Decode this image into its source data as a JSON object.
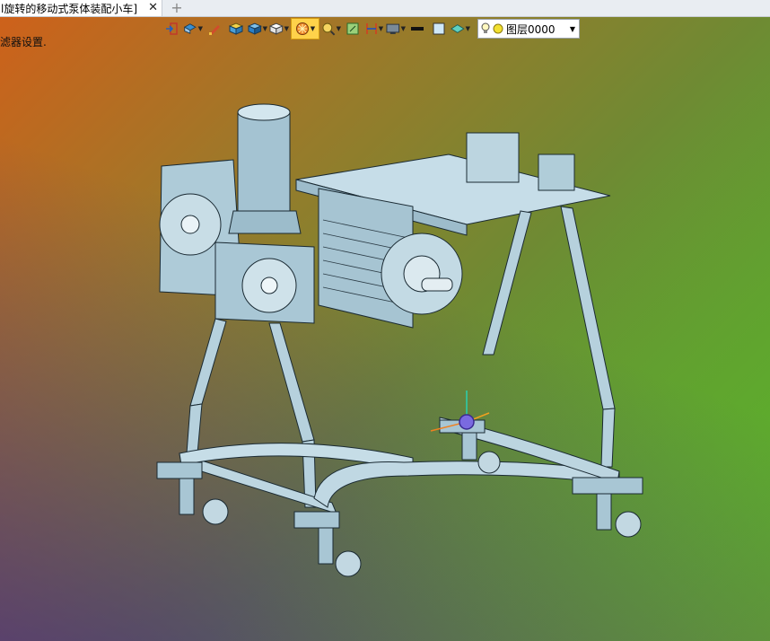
{
  "tab": {
    "title": "l旋转的移动式泵体装配小车]",
    "close_glyph": "✕",
    "add_glyph": "+"
  },
  "toolbar": {
    "icons": [
      "exit-icon",
      "view-orientation-icon",
      "pen-icon",
      "solid-box-icon",
      "cube-view-icon",
      "white-cube-icon",
      "render-mode-icon",
      "zoom-icon",
      "fit-view-icon",
      "section-icon",
      "display-mode-icon",
      "line-style-icon",
      "color-swatch-icon",
      "plane-icon"
    ],
    "layer_label": "图层0000"
  },
  "status": {
    "message": "滤器设置."
  },
  "colors": {
    "model_fill": "#b8d4e0",
    "model_stroke": "#1a2a33",
    "active_button": "#ffd24a"
  }
}
